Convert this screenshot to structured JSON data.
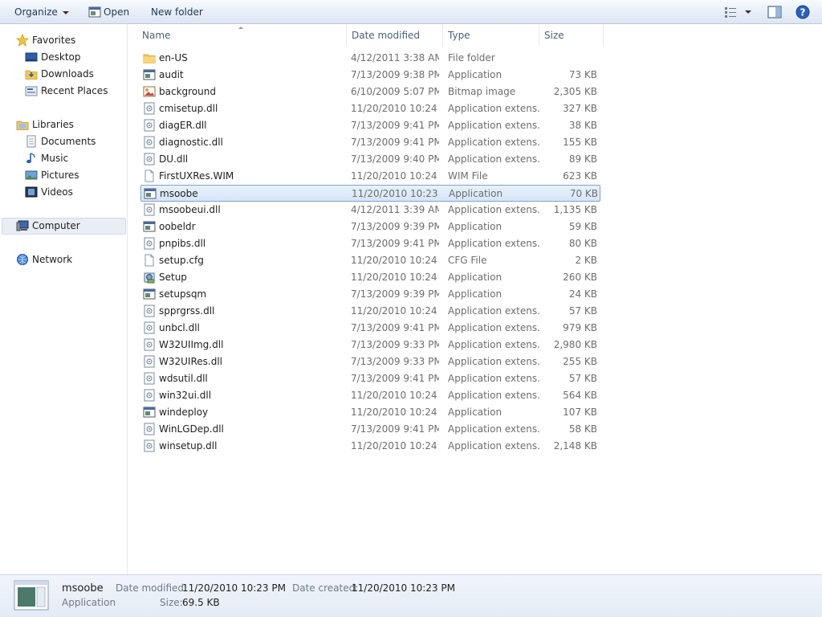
{
  "toolbar": {
    "organize_label": "Organize",
    "open_label": "Open",
    "new_folder_label": "New folder"
  },
  "nav": {
    "favorites": "Favorites",
    "desktop": "Desktop",
    "downloads": "Downloads",
    "recent_places": "Recent Places",
    "libraries": "Libraries",
    "documents": "Documents",
    "music": "Music",
    "pictures": "Pictures",
    "videos": "Videos",
    "computer": "Computer",
    "network": "Network"
  },
  "columns": {
    "name": "Name",
    "date_modified": "Date modified",
    "type": "Type",
    "size": "Size"
  },
  "files": [
    {
      "name": "en-US",
      "date": "4/12/2011 3:38 AM",
      "type": "File folder",
      "size": "",
      "icon": "folder-icon"
    },
    {
      "name": "audit",
      "date": "7/13/2009 9:38 PM",
      "type": "Application",
      "size": "73 KB",
      "icon": "application-icon"
    },
    {
      "name": "background",
      "date": "6/10/2009 5:07 PM",
      "type": "Bitmap image",
      "size": "2,305 KB",
      "icon": "bitmap-icon"
    },
    {
      "name": "cmisetup.dll",
      "date": "11/20/2010 10:24 ...",
      "type": "Application extens...",
      "size": "327 KB",
      "icon": "dll-icon"
    },
    {
      "name": "diagER.dll",
      "date": "7/13/2009 9:41 PM",
      "type": "Application extens...",
      "size": "38 KB",
      "icon": "dll-icon"
    },
    {
      "name": "diagnostic.dll",
      "date": "7/13/2009 9:41 PM",
      "type": "Application extens...",
      "size": "155 KB",
      "icon": "dll-icon"
    },
    {
      "name": "DU.dll",
      "date": "7/13/2009 9:40 PM",
      "type": "Application extens...",
      "size": "89 KB",
      "icon": "dll-icon"
    },
    {
      "name": "FirstUXRes.WIM",
      "date": "11/20/2010 10:24 ...",
      "type": "WIM File",
      "size": "623 KB",
      "icon": "blank-file-icon"
    },
    {
      "name": "msoobe",
      "date": "11/20/2010 10:23 ...",
      "type": "Application",
      "size": "70 KB",
      "icon": "application-icon",
      "selected": true
    },
    {
      "name": "msoobeui.dll",
      "date": "4/12/2011 3:39 AM",
      "type": "Application extens...",
      "size": "1,135 KB",
      "icon": "dll-icon"
    },
    {
      "name": "oobeldr",
      "date": "7/13/2009 9:39 PM",
      "type": "Application",
      "size": "59 KB",
      "icon": "application-icon"
    },
    {
      "name": "pnpibs.dll",
      "date": "7/13/2009 9:41 PM",
      "type": "Application extens...",
      "size": "80 KB",
      "icon": "dll-icon"
    },
    {
      "name": "setup.cfg",
      "date": "11/20/2010 10:24 ...",
      "type": "CFG File",
      "size": "2 KB",
      "icon": "blank-file-icon"
    },
    {
      "name": "Setup",
      "date": "11/20/2010 10:24 ...",
      "type": "Application",
      "size": "260 KB",
      "icon": "setup-icon"
    },
    {
      "name": "setupsqm",
      "date": "7/13/2009 9:39 PM",
      "type": "Application",
      "size": "24 KB",
      "icon": "application-icon"
    },
    {
      "name": "spprgrss.dll",
      "date": "11/20/2010 10:24 ...",
      "type": "Application extens...",
      "size": "57 KB",
      "icon": "dll-icon"
    },
    {
      "name": "unbcl.dll",
      "date": "7/13/2009 9:41 PM",
      "type": "Application extens...",
      "size": "979 KB",
      "icon": "dll-icon"
    },
    {
      "name": "W32UIImg.dll",
      "date": "7/13/2009 9:33 PM",
      "type": "Application extens...",
      "size": "2,980 KB",
      "icon": "dll-icon"
    },
    {
      "name": "W32UIRes.dll",
      "date": "7/13/2009 9:33 PM",
      "type": "Application extens...",
      "size": "255 KB",
      "icon": "dll-icon"
    },
    {
      "name": "wdsutil.dll",
      "date": "7/13/2009 9:41 PM",
      "type": "Application extens...",
      "size": "57 KB",
      "icon": "dll-icon"
    },
    {
      "name": "win32ui.dll",
      "date": "11/20/2010 10:24 ...",
      "type": "Application extens...",
      "size": "564 KB",
      "icon": "dll-icon"
    },
    {
      "name": "windeploy",
      "date": "11/20/2010 10:24 ...",
      "type": "Application",
      "size": "107 KB",
      "icon": "application-icon"
    },
    {
      "name": "WinLGDep.dll",
      "date": "7/13/2009 9:41 PM",
      "type": "Application extens...",
      "size": "58 KB",
      "icon": "dll-icon"
    },
    {
      "name": "winsetup.dll",
      "date": "11/20/2010 10:24 ...",
      "type": "Application extens...",
      "size": "2,148 KB",
      "icon": "dll-icon"
    }
  ],
  "details": {
    "name": "msoobe",
    "type": "Application",
    "date_modified_label": "Date modified:",
    "date_modified": "11/20/2010 10:23 PM",
    "date_created_label": "Date created:",
    "date_created": "11/20/2010 10:23 PM",
    "size_label": "Size:",
    "size": "69.5 KB"
  },
  "colors": {
    "selection_fill": "#d6e6f8",
    "selection_border": "#7da2ce",
    "toolbar_text": "#1e395b"
  }
}
